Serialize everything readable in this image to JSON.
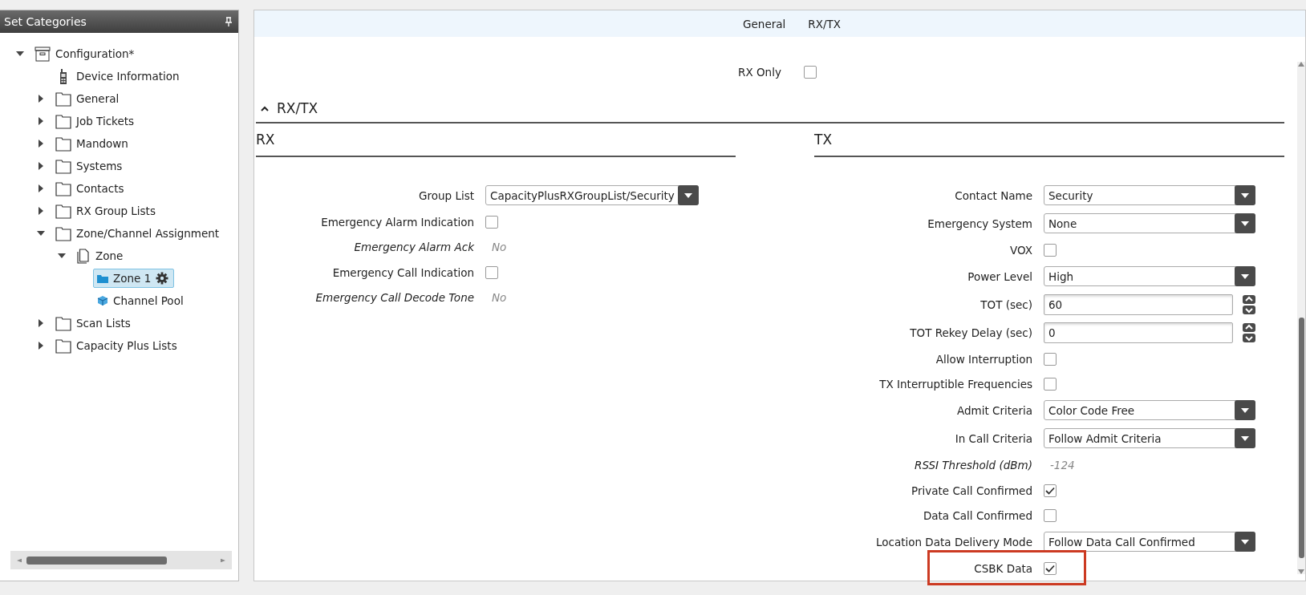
{
  "sidebar": {
    "title": "Set Categories",
    "pinned": true,
    "items": [
      {
        "label": "Configuration*",
        "kind": "archive",
        "expanded": true,
        "selected": false,
        "children": [
          {
            "label": "Device Information",
            "kind": "device",
            "selected": false
          },
          {
            "label": "General",
            "kind": "folder",
            "expanded": false,
            "selected": false
          },
          {
            "label": "Job Tickets",
            "kind": "folder",
            "expanded": false,
            "selected": false
          },
          {
            "label": "Mandown",
            "kind": "folder",
            "expanded": false,
            "selected": false
          },
          {
            "label": "Systems",
            "kind": "folder",
            "expanded": false,
            "selected": false
          },
          {
            "label": "Contacts",
            "kind": "folder",
            "expanded": false,
            "selected": false
          },
          {
            "label": "RX Group Lists",
            "kind": "folder",
            "expanded": false,
            "selected": false
          },
          {
            "label": "Zone/Channel Assignment",
            "kind": "folder",
            "expanded": true,
            "selected": false,
            "children": [
              {
                "label": "Zone",
                "kind": "pages",
                "expanded": true,
                "selected": false,
                "children": [
                  {
                    "label": "Zone 1",
                    "kind": "zone",
                    "selected": true,
                    "settings": true
                  },
                  {
                    "label": "Channel Pool",
                    "kind": "cube",
                    "selected": false
                  }
                ]
              }
            ]
          },
          {
            "label": "Scan Lists",
            "kind": "folder",
            "expanded": false,
            "selected": false
          },
          {
            "label": "Capacity Plus Lists",
            "kind": "folder",
            "expanded": false,
            "selected": false
          }
        ]
      }
    ]
  },
  "header": {
    "links": [
      "General",
      "RX/TX"
    ]
  },
  "rx_only": {
    "label": "RX Only",
    "checked": false
  },
  "section": {
    "title": "RX/TX",
    "expanded": true
  },
  "rx": {
    "title": "RX",
    "rows": [
      {
        "kind": "dropdown",
        "label": "Group List",
        "value": "CapacityPlusRXGroupList/Security"
      },
      {
        "kind": "checkbox",
        "label": "Emergency Alarm Indication",
        "checked": false
      },
      {
        "kind": "readonly",
        "label": "Emergency Alarm Ack",
        "value": "No"
      },
      {
        "kind": "checkbox",
        "label": "Emergency Call Indication",
        "checked": false
      },
      {
        "kind": "readonly",
        "label": "Emergency Call Decode Tone",
        "value": "No"
      }
    ]
  },
  "tx": {
    "title": "TX",
    "rows": [
      {
        "kind": "dropdown",
        "label": "Contact Name",
        "value": "Security"
      },
      {
        "kind": "dropdown",
        "label": "Emergency System",
        "value": "None"
      },
      {
        "kind": "checkbox",
        "label": "VOX",
        "checked": false
      },
      {
        "kind": "dropdown",
        "label": "Power Level",
        "value": "High"
      },
      {
        "kind": "spinner",
        "label": "TOT (sec)",
        "value": "60"
      },
      {
        "kind": "spinner",
        "label": "TOT Rekey Delay (sec)",
        "value": "0"
      },
      {
        "kind": "checkbox",
        "label": "Allow Interruption",
        "checked": false
      },
      {
        "kind": "checkbox",
        "label": "TX Interruptible Frequencies",
        "checked": false
      },
      {
        "kind": "dropdown",
        "label": "Admit Criteria",
        "value": "Color Code Free"
      },
      {
        "kind": "dropdown",
        "label": "In Call Criteria",
        "value": "Follow Admit Criteria"
      },
      {
        "kind": "readonly",
        "label": "RSSI Threshold (dBm)",
        "value": "-124"
      },
      {
        "kind": "checkbox",
        "label": "Private Call Confirmed",
        "checked": true
      },
      {
        "kind": "checkbox",
        "label": "Data Call Confirmed",
        "checked": false
      },
      {
        "kind": "dropdown",
        "label": "Location Data Delivery Mode",
        "value": "Follow Data Call Confirmed"
      },
      {
        "kind": "checkbox",
        "label": "CSBK Data",
        "checked": true,
        "highlighted": true
      }
    ]
  }
}
